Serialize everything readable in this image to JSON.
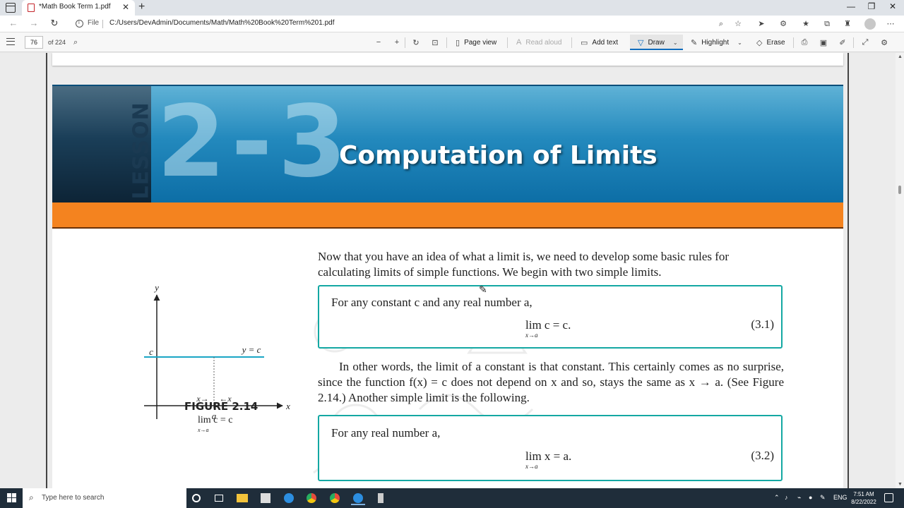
{
  "browser": {
    "tab_title": "*Math Book Term 1.pdf",
    "tab_close": "✕",
    "new_tab": "+",
    "url_label": "File",
    "url": "C:/Users/DevAdmin/Documents/Math/Math%20Book%20Term%201.pdf",
    "window_controls": {
      "minimize": "—",
      "maximize": "❐",
      "close": "✕"
    }
  },
  "pdf_toolbar": {
    "page_number": "76",
    "page_total": "of 224",
    "page_view_label": "Page view",
    "read_aloud_label": "Read aloud",
    "add_text_label": "Add text",
    "draw_label": "Draw",
    "highlight_label": "Highlight",
    "erase_label": "Erase"
  },
  "lesson": {
    "tag": "LESSON",
    "number": "2-3",
    "title": "Computation of Limits"
  },
  "content": {
    "intro": "Now that you have an idea of what a limit is, we need to develop some basic rules for calculating limits of simple functions. We begin with two simple limits.",
    "box1": {
      "lead": "For any constant c and any real number a,",
      "eq": "lim c = c.",
      "sub": "x→a",
      "num": "(3.1)"
    },
    "para2": "In other words, the limit of a constant is that constant. This certainly comes as no surprise, since the function f(x) = c does not depend on x and so, stays the same as x → a. (See Figure 2.14.) Another simple limit is the following.",
    "box2": {
      "lead": "For any real number a,",
      "eq": "lim x = a.",
      "sub": "x→a",
      "num": "(3.2)"
    }
  },
  "figure": {
    "caption": "FIGURE 2.14",
    "formula": "lim c = c",
    "formula_sub": "x→a",
    "y_axis": "y",
    "x_axis": "x",
    "c_label": "c",
    "line_label": "y = c",
    "left_arrow": "x→",
    "right_arrow": "←x",
    "a_label": "a"
  },
  "taskbar": {
    "search_placeholder": "Type here to search",
    "lang": "ENG",
    "time": "7:51 AM",
    "date": "8/22/2022"
  },
  "colors": {
    "banner_blue": "#1f86bb",
    "banner_orange": "#f4831f",
    "box_border": "#14a8a3",
    "draw_accent": "#0f6cbd"
  }
}
